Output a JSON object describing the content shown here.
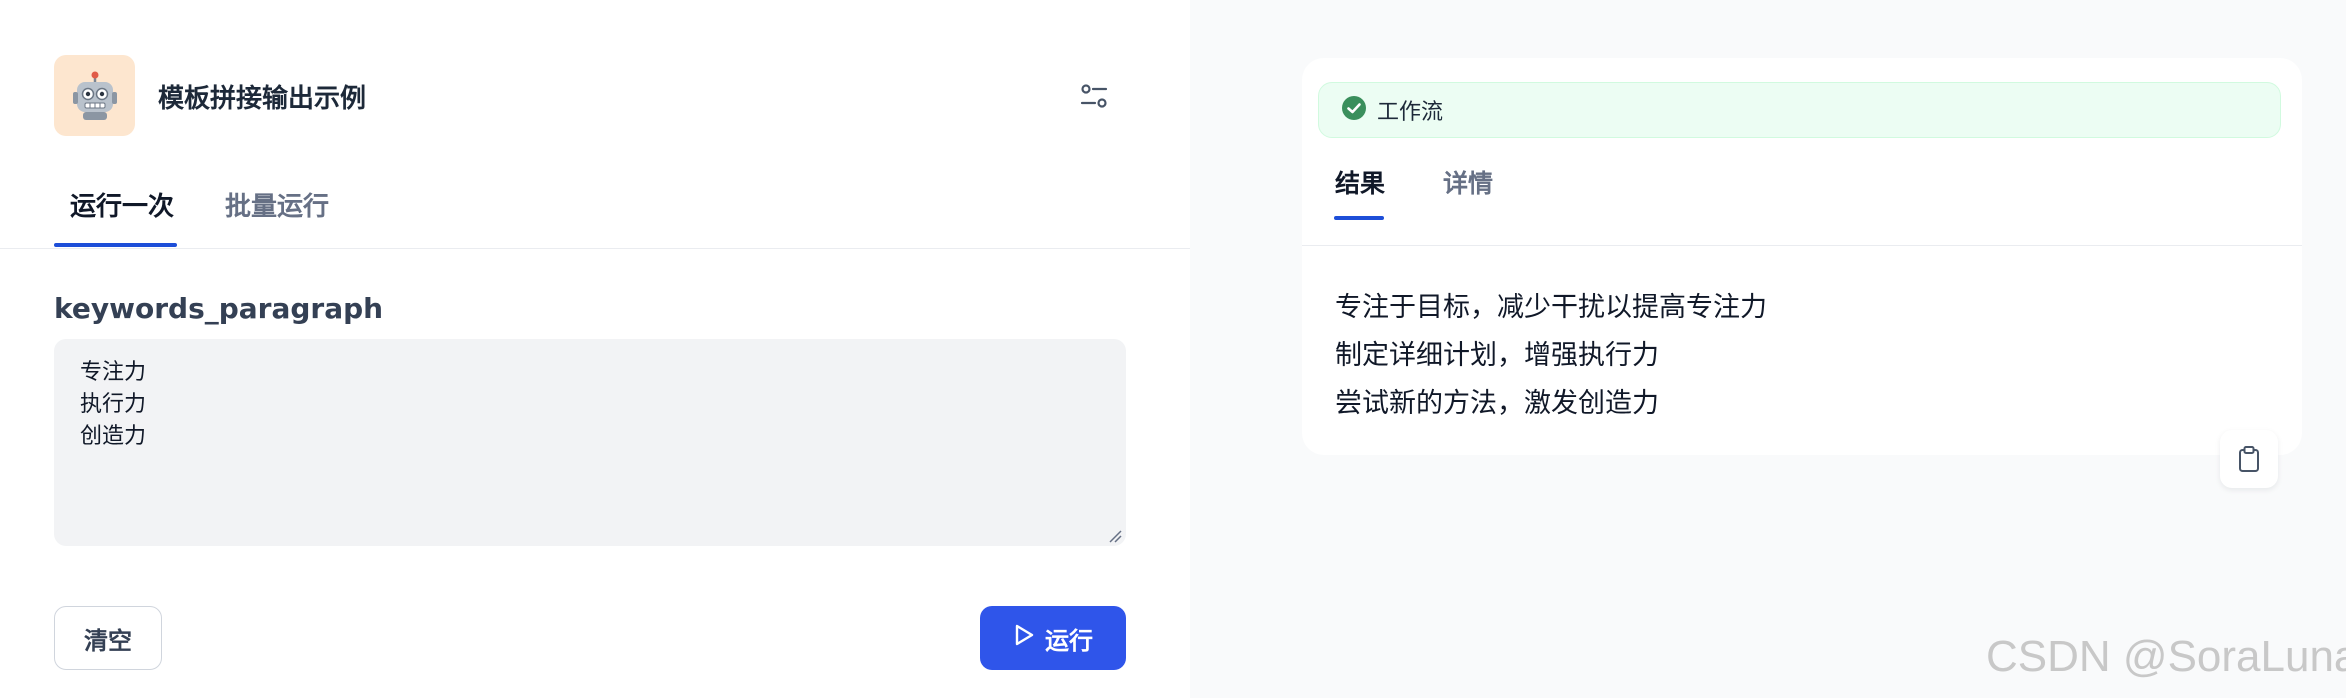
{
  "app": {
    "title": "模板拼接输出示例",
    "icon": "robot-emoji"
  },
  "tabs": {
    "run_once": "运行一次",
    "batch_run": "批量运行",
    "active": "run_once"
  },
  "form": {
    "field_label": "keywords_paragraph",
    "field_value": "专注力\n执行力\n创造力"
  },
  "actions": {
    "clear_label": "清空",
    "run_label": "运行"
  },
  "result": {
    "workflow_label": "工作流",
    "workflow_status": "success",
    "tabs": {
      "result": "结果",
      "detail": "详情",
      "active": "result"
    },
    "lines": [
      "专注于目标，减少干扰以提高专注力",
      "制定详细计划，增强执行力",
      "尝试新的方法，激发创造力"
    ]
  },
  "watermark": "CSDN @SoraLuna",
  "colors": {
    "accent": "#2f55ea",
    "success": "#12b76a",
    "icon_bg": "#fde6cf"
  }
}
